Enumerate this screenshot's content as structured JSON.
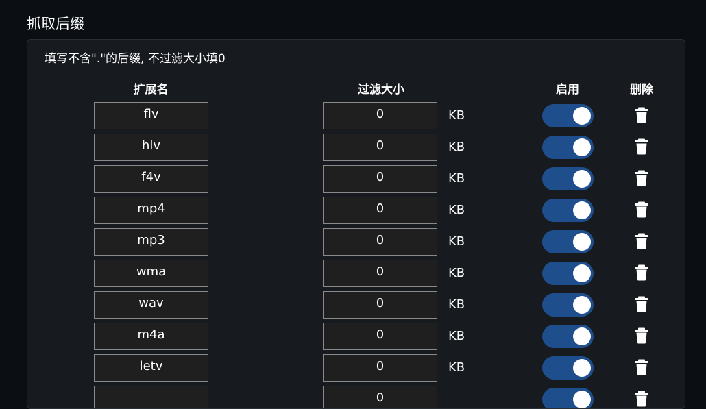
{
  "section": {
    "title": "抓取后缀"
  },
  "panel": {
    "hint": "填写不含\".\"的后缀, 不过滤大小填0"
  },
  "table": {
    "headers": {
      "extension": "扩展名",
      "filter_size": "过滤大小",
      "enable": "启用",
      "delete": "删除"
    },
    "rows": [
      {
        "ext": "flv",
        "size": "0",
        "unit": "KB",
        "enabled": true
      },
      {
        "ext": "hlv",
        "size": "0",
        "unit": "KB",
        "enabled": true
      },
      {
        "ext": "f4v",
        "size": "0",
        "unit": "KB",
        "enabled": true
      },
      {
        "ext": "mp4",
        "size": "0",
        "unit": "KB",
        "enabled": true
      },
      {
        "ext": "mp3",
        "size": "0",
        "unit": "KB",
        "enabled": true
      },
      {
        "ext": "wma",
        "size": "0",
        "unit": "KB",
        "enabled": true
      },
      {
        "ext": "wav",
        "size": "0",
        "unit": "KB",
        "enabled": true
      },
      {
        "ext": "m4a",
        "size": "0",
        "unit": "KB",
        "enabled": true
      },
      {
        "ext": "letv",
        "size": "0",
        "unit": "KB",
        "enabled": true
      },
      {
        "ext": "",
        "size": "0",
        "unit": "",
        "enabled": true
      }
    ]
  },
  "colors": {
    "page_background": "#0b0f14",
    "panel_background": "#171a1f",
    "toggle_on": "#1f4e8c",
    "input_background": "#1f1f1f"
  },
  "icons": {
    "delete": "trash-icon"
  }
}
